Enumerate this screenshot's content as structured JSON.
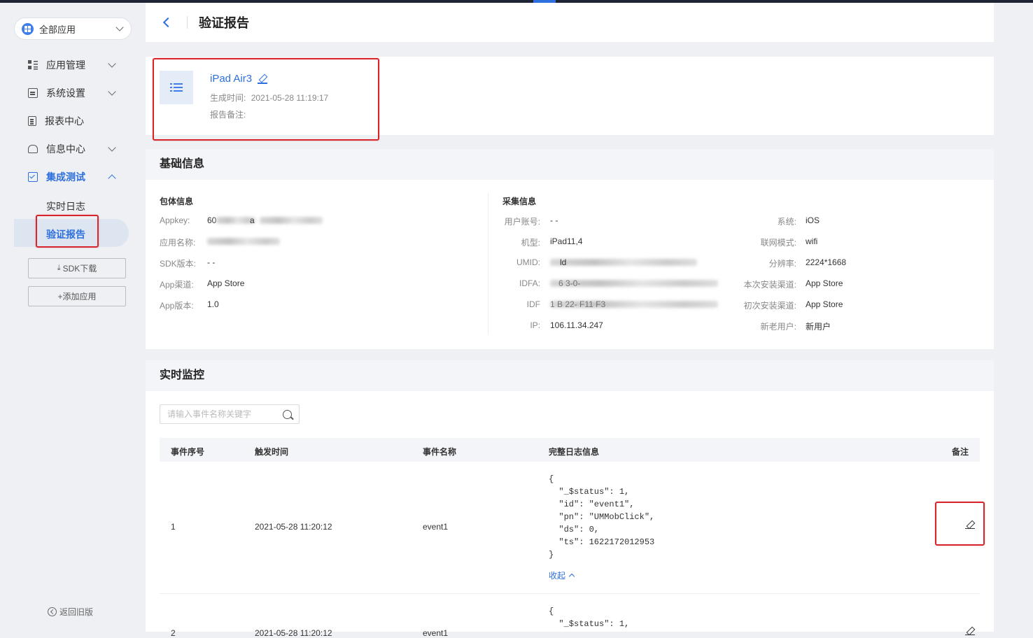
{
  "sidebar": {
    "app_selector": "全部应用",
    "nav": [
      {
        "label": "应用管理"
      },
      {
        "label": "系统设置"
      },
      {
        "label": "报表中心"
      },
      {
        "label": "信息中心"
      },
      {
        "label": "集成测试"
      }
    ],
    "sub": [
      {
        "label": "实时日志"
      },
      {
        "label": "验证报告"
      }
    ],
    "sdk_button": "SDK下载",
    "add_app_button": "+添加应用",
    "back_old": "返回旧版"
  },
  "header": {
    "title": "验证报告"
  },
  "report": {
    "name": "iPad Air3",
    "generated_label": "生成时间:",
    "generated_time": "2021-05-28 11:19:17",
    "note_label": "报告备注:"
  },
  "basic": {
    "title": "基础信息",
    "package_title": "包体信息",
    "package": [
      {
        "label": "Appkey:",
        "value": "60",
        "value2": "a"
      },
      {
        "label": "应用名称:",
        "value": ""
      },
      {
        "label": "SDK版本:",
        "value": "- -"
      },
      {
        "label": "App渠道:",
        "value": "App Store"
      },
      {
        "label": "App版本:",
        "value": "1.0"
      }
    ],
    "collect_title": "采集信息",
    "collect_left": [
      {
        "label": "用户账号:",
        "value": "- -"
      },
      {
        "label": "机型:",
        "value": "iPad11,4"
      },
      {
        "label": "UMID:",
        "value": "ld"
      },
      {
        "label": "IDFA:",
        "value": "6   3-0-"
      },
      {
        "label": "IDF",
        "value": "1  B  22-   F11   F3"
      },
      {
        "label": "IP:",
        "value": "106.11.34.247"
      }
    ],
    "collect_right": [
      {
        "label": "系统:",
        "value": "iOS"
      },
      {
        "label": "联网模式:",
        "value": "wifi"
      },
      {
        "label": "分辨率:",
        "value": "2224*1668"
      },
      {
        "label": "本次安装渠道:",
        "value": "App Store"
      },
      {
        "label": "初次安装渠道:",
        "value": "App Store"
      },
      {
        "label": "新老用户:",
        "value": "新用户"
      }
    ]
  },
  "monitor": {
    "title": "实时监控",
    "search_placeholder": "请输入事件名称关键字",
    "columns": [
      "事件序号",
      "触发时间",
      "事件名称",
      "完整日志信息",
      "备注"
    ],
    "rows": [
      {
        "index": "1",
        "time": "2021-05-28 11:20:12",
        "event": "event1",
        "log": "{\n  \"_$status\": 1,\n  \"id\": \"event1\",\n  \"pn\": \"UMMobClick\",\n  \"ds\": 0,\n  \"ts\": 1622172012953\n}",
        "collapse": "收起"
      },
      {
        "index": "2",
        "time": "2021-05-28 11:20:12",
        "event": "event1",
        "log": "{\n  \"_$status\": 1,"
      }
    ]
  },
  "colors": {
    "accent": "#2d6fdd",
    "highlight_box": "#d8242b",
    "sidebar_bg": "#eef0f4",
    "topbar": "#1f2435"
  }
}
